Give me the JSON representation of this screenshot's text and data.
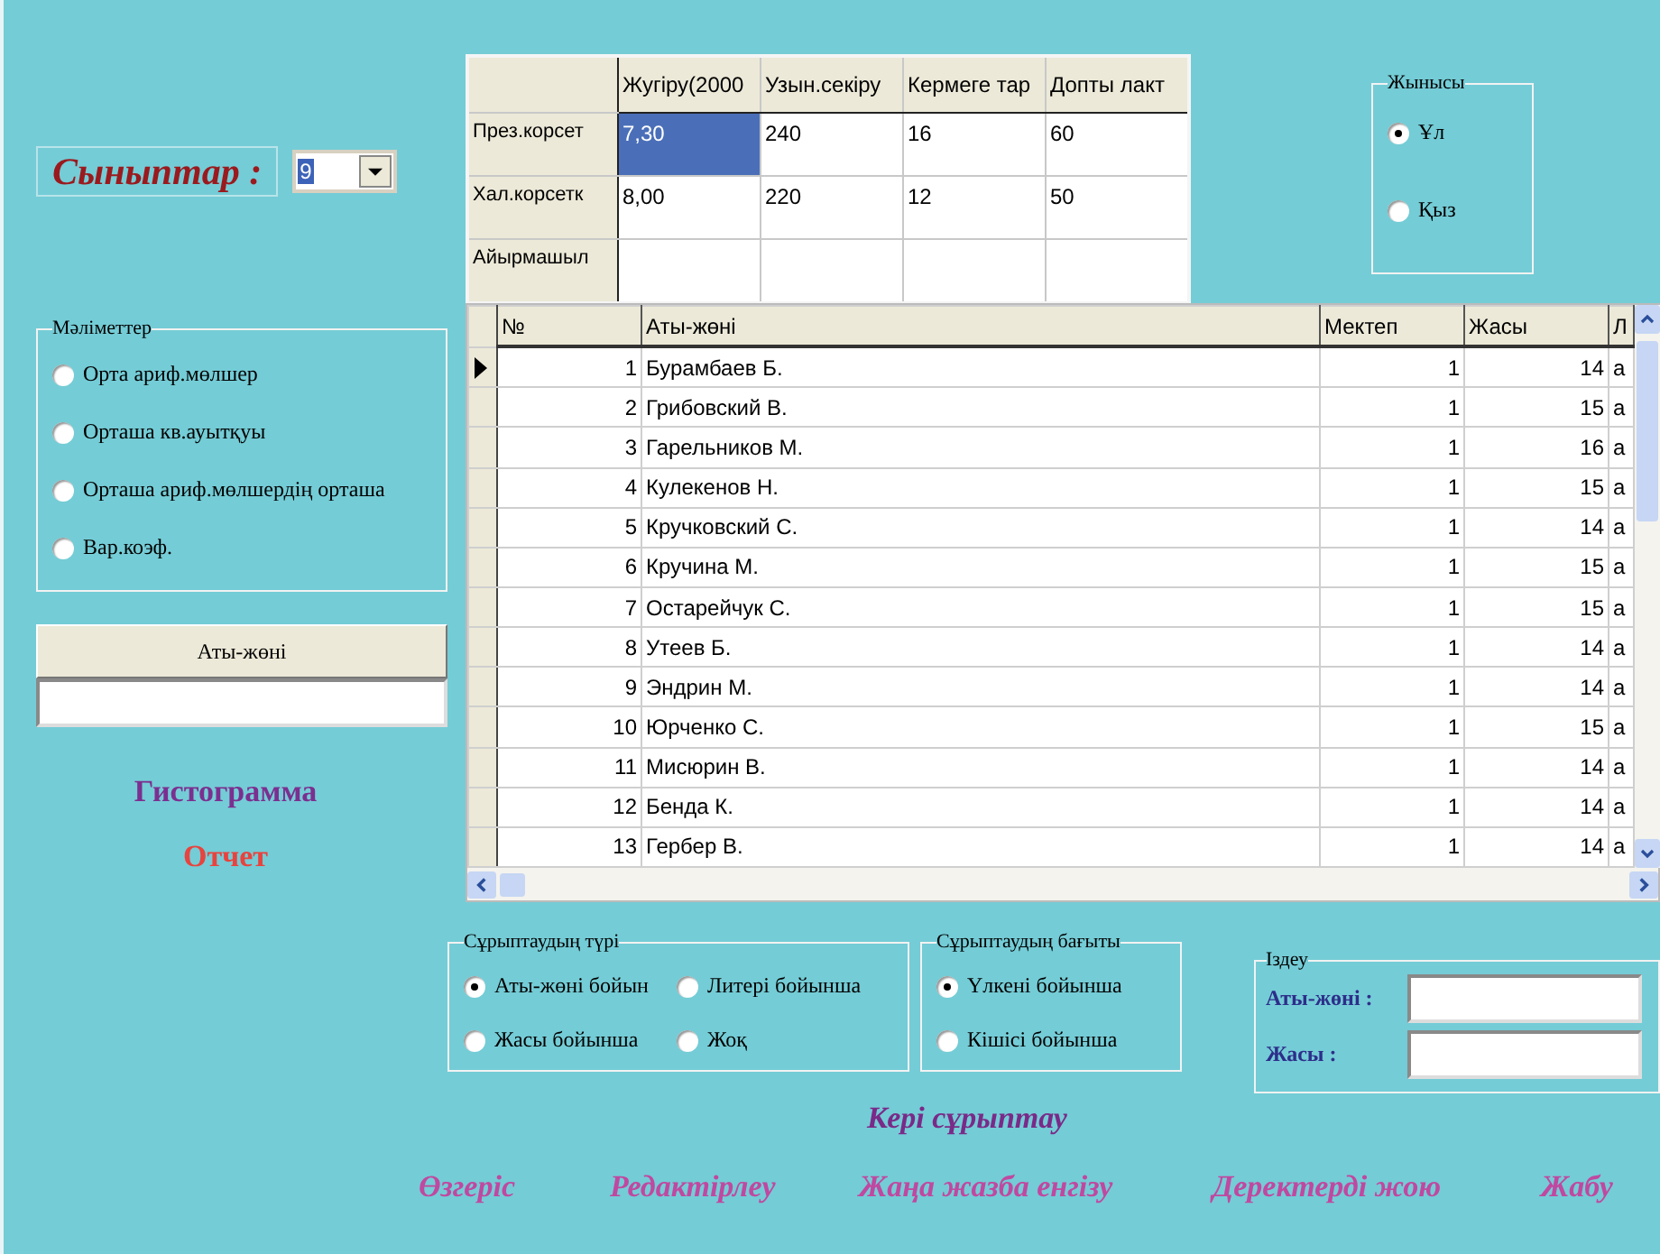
{
  "class_selector": {
    "label": "Сыныптар :",
    "value": "9"
  },
  "stats_table": {
    "columns": [
      "Жугіру(2000",
      "Узын.секіру",
      "Кермеге тар",
      "Допты лакт"
    ],
    "rows": [
      {
        "header": "През.корсет",
        "cells": [
          {
            "text": "7,30",
            "selected": true
          },
          {
            "text": "240",
            "selected": false
          },
          {
            "text": "16",
            "selected": false
          },
          {
            "text": "60",
            "selected": false
          }
        ]
      },
      {
        "header": "Хал.корсетк",
        "cells": [
          {
            "text": "8,00",
            "selected": false
          },
          {
            "text": "220",
            "selected": false
          },
          {
            "text": "12",
            "selected": false
          },
          {
            "text": "50",
            "selected": false
          }
        ]
      },
      {
        "header": "Айырмашыл",
        "cells": []
      }
    ]
  },
  "gender": {
    "title": "Жынысы",
    "options": [
      {
        "label": "Ұл",
        "selected": true
      },
      {
        "label": "Қыз",
        "selected": false
      }
    ]
  },
  "data_group": {
    "title": "Мәліметтер",
    "options": [
      {
        "label": "Орта ариф.мөлшер",
        "selected": false
      },
      {
        "label": "Орташа кв.ауытқуы",
        "selected": false
      },
      {
        "label": "Орташа ариф.мөлшердің орташа",
        "selected": false
      },
      {
        "label": "Вар.коэф.",
        "selected": false
      }
    ]
  },
  "name_button": "Аты-жөні",
  "side_links": [
    {
      "label": "Гистограмма",
      "color": "#7b2f8f"
    },
    {
      "label": "Отчет",
      "color": "#e8433e"
    }
  ],
  "grid": {
    "columns": [
      "№",
      "Аты-жөні",
      "Мектеп",
      "Жасы",
      "Л"
    ],
    "rows": [
      {
        "selected": true,
        "cells": [
          "1",
          "Бурамбаев Б.",
          "1",
          "14",
          "а"
        ]
      },
      {
        "selected": false,
        "cells": [
          "2",
          "Грибовский В.",
          "1",
          "15",
          "а"
        ]
      },
      {
        "selected": false,
        "cells": [
          "3",
          "Гарельников М.",
          "1",
          "16",
          "а"
        ]
      },
      {
        "selected": false,
        "cells": [
          "4",
          "Кулекенов Н.",
          "1",
          "15",
          "а"
        ]
      },
      {
        "selected": false,
        "cells": [
          "5",
          "Кручковский С.",
          "1",
          "14",
          "а"
        ]
      },
      {
        "selected": false,
        "cells": [
          "6",
          "Кручина М.",
          "1",
          "15",
          "а"
        ]
      },
      {
        "selected": false,
        "cells": [
          "7",
          "Остарейчук С.",
          "1",
          "15",
          "а"
        ]
      },
      {
        "selected": false,
        "cells": [
          "8",
          "Утеев Б.",
          "1",
          "14",
          "а"
        ]
      },
      {
        "selected": false,
        "cells": [
          "9",
          "Эндрин М.",
          "1",
          "14",
          "а"
        ]
      },
      {
        "selected": false,
        "cells": [
          "10",
          "Юрченко С.",
          "1",
          "15",
          "а"
        ]
      },
      {
        "selected": false,
        "cells": [
          "11",
          "Мисюрин В.",
          "1",
          "14",
          "а"
        ]
      },
      {
        "selected": false,
        "cells": [
          "12",
          "Бенда К.",
          "1",
          "14",
          "а"
        ]
      },
      {
        "selected": false,
        "cells": [
          "13",
          "Гербер В.",
          "1",
          "14",
          "а"
        ]
      }
    ]
  },
  "sort_type": {
    "title": "Сұрыптаудың түрі",
    "options": [
      {
        "label": "Аты-жөні бойын",
        "selected": true
      },
      {
        "label": "Литері бойынша",
        "selected": false
      },
      {
        "label": "Жасы бойынша",
        "selected": false
      },
      {
        "label": "Жоқ",
        "selected": false
      }
    ]
  },
  "sort_direction": {
    "title": "Сұрыптаудың бағыты",
    "options": [
      {
        "label": "Үлкені бойынша",
        "selected": true
      },
      {
        "label": "Кішісі бойынша",
        "selected": false
      }
    ]
  },
  "search": {
    "title": "Іздеу",
    "fields": [
      {
        "label": "Аты-жөні :"
      },
      {
        "label": "Жасы :"
      }
    ]
  },
  "reverse_sort": "Кері сұрыптау",
  "actions": [
    "Өзгеріс",
    "Редактірлеу",
    "Жаңа жазба енгізу",
    "Деректерді жою",
    "Жабу"
  ]
}
